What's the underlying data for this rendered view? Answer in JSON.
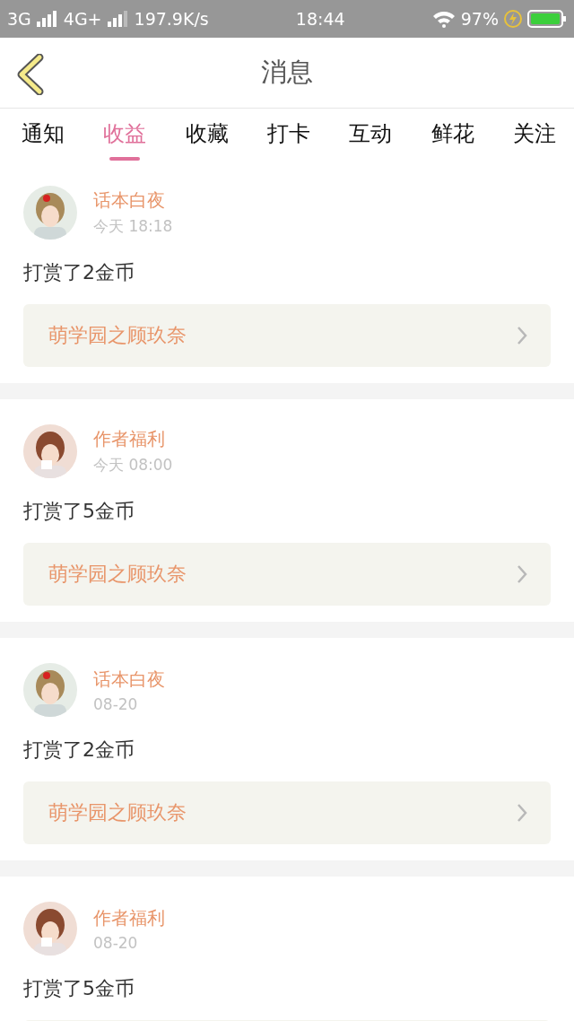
{
  "status_bar": {
    "network_1": "3G",
    "network_2": "4G+",
    "speed": "197.9K/s",
    "time": "18:44",
    "battery": "97%"
  },
  "header": {
    "title": "消息"
  },
  "tabs": [
    {
      "label": "通知",
      "selected": false
    },
    {
      "label": "收益",
      "selected": true
    },
    {
      "label": "收藏",
      "selected": false
    },
    {
      "label": "打卡",
      "selected": false
    },
    {
      "label": "互动",
      "selected": false
    },
    {
      "label": "鲜花",
      "selected": false
    },
    {
      "label": "关注",
      "selected": false
    }
  ],
  "messages": [
    {
      "user": "话本白夜",
      "time": "今天 18:18",
      "text": "打赏了2金币",
      "book": "萌学园之顾玖奈"
    },
    {
      "user": "作者福利",
      "time": "今天 08:00",
      "text": "打赏了5金币",
      "book": "萌学园之顾玖奈"
    },
    {
      "user": "话本白夜",
      "time": "08-20",
      "text": "打赏了2金币",
      "book": "萌学园之顾玖奈"
    },
    {
      "user": "作者福利",
      "time": "08-20",
      "text": "打赏了5金币"
    }
  ]
}
